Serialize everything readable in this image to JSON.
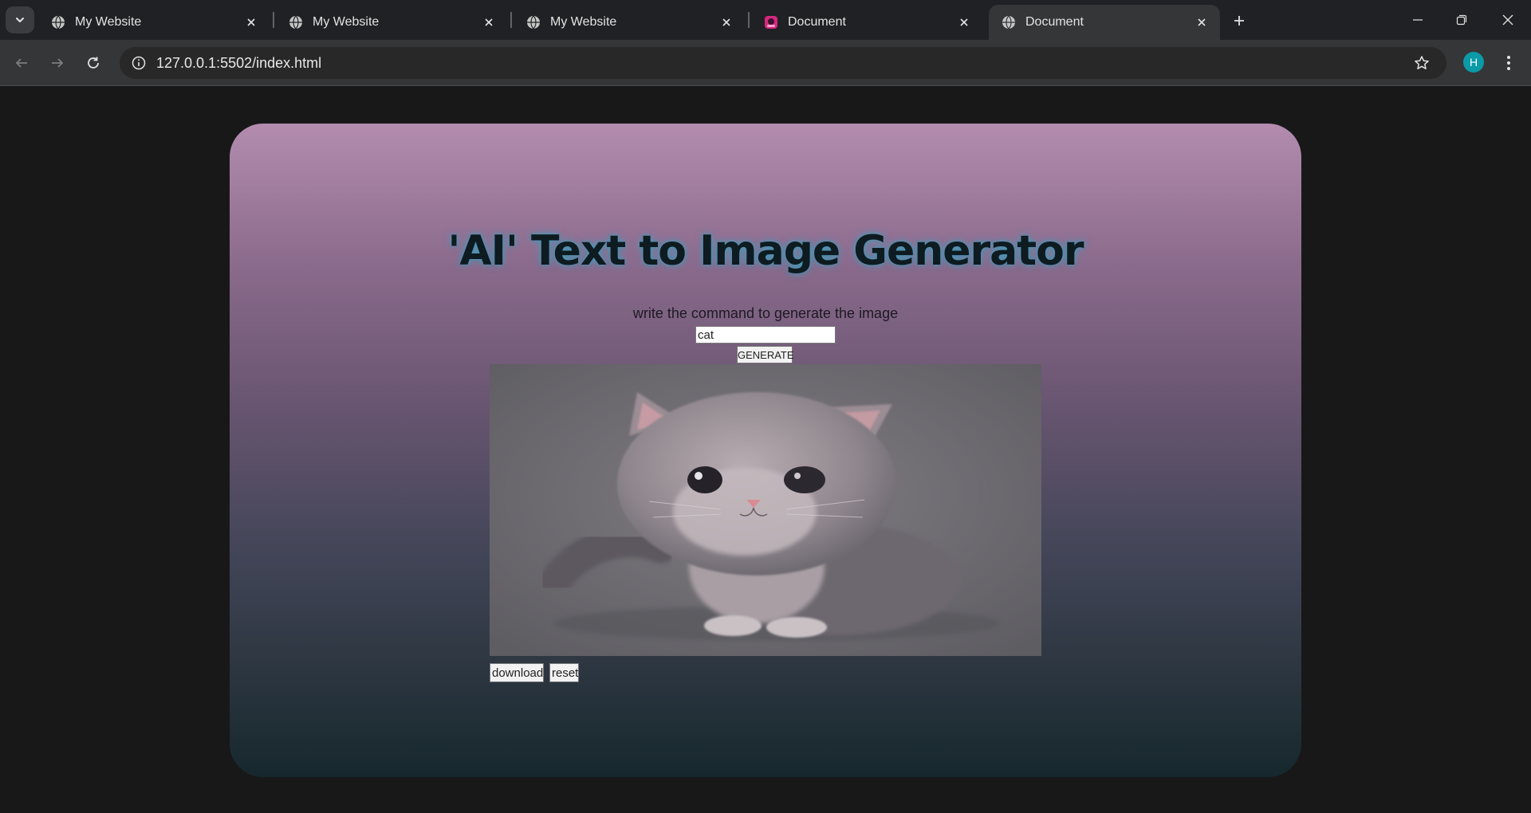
{
  "browser": {
    "tabs": [
      {
        "title": "My Website",
        "favicon": "globe-icon",
        "active": false
      },
      {
        "title": "My Website",
        "favicon": "globe-icon",
        "active": false
      },
      {
        "title": "My Website",
        "favicon": "globe-icon",
        "active": false
      },
      {
        "title": "Document",
        "favicon": "pink-app-icon",
        "active": false
      },
      {
        "title": "Document",
        "favicon": "globe-icon",
        "active": true
      }
    ],
    "address": "127.0.0.1:5502/index.html",
    "profile_initial": "H",
    "colors": {
      "tabstrip": "#202124",
      "toolbar": "#353638",
      "omnibox": "#282828",
      "avatar": "#0b9aa7"
    }
  },
  "page": {
    "title": "'AI' Text to Image Generator",
    "prompt_label": "write the command to generate the image",
    "prompt_value": "cat",
    "generate_label": "GENERATE",
    "image_alt": "generated image of a fluffy grey kitten",
    "download_label": "download",
    "reset_label": "reset",
    "colors": {
      "gradient_top": "#b38caf",
      "gradient_bottom": "#16282d",
      "title_text": "#0e1b20",
      "title_glow": "#28aac8",
      "page_bg": "#181818"
    }
  }
}
